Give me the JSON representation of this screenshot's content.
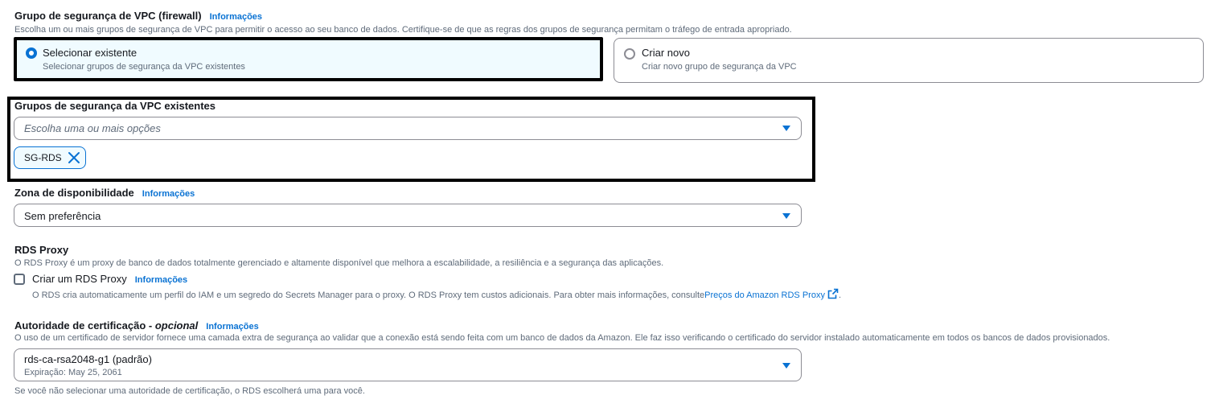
{
  "vpc_sg": {
    "title": "Grupo de segurança de VPC (firewall)",
    "info": "Informações",
    "description": "Escolha um ou mais grupos de segurança de VPC para permitir o acesso ao seu banco de dados. Certifique-se de que as regras dos grupos de segurança permitam o tráfego de entrada apropriado.",
    "options": [
      {
        "label": "Selecionar existente",
        "description": "Selecionar grupos de segurança da VPC existentes",
        "selected": true
      },
      {
        "label": "Criar novo",
        "description": "Criar novo grupo de segurança da VPC",
        "selected": false
      }
    ]
  },
  "existing_sg": {
    "title": "Grupos de segurança da VPC existentes",
    "placeholder": "Escolha uma ou mais opções",
    "tokens": [
      "SG-RDS"
    ]
  },
  "az": {
    "title": "Zona de disponibilidade",
    "info": "Informações",
    "value": "Sem preferência"
  },
  "rds_proxy": {
    "title": "RDS Proxy",
    "description": "O RDS Proxy é um proxy de banco de dados totalmente gerenciado e altamente disponível que melhora a escalabilidade, a resiliência e a segurança das aplicações.",
    "checkbox_label": "Criar um RDS Proxy",
    "info": "Informações",
    "checked": false,
    "sub_description": "O RDS cria automaticamente um perfil do IAM e um segredo do Secrets Manager para o proxy. O RDS Proxy tem custos adicionais. Para obter mais informações, consulte",
    "link": "Preços do Amazon RDS Proxy",
    "after_link": "."
  },
  "ca": {
    "title": "Autoridade de certificação - ",
    "optional": "opcional",
    "info": "Informações",
    "description": "O uso de um certificado de servidor fornece uma camada extra de segurança ao validar que a conexão está sendo feita com um banco de dados da Amazon. Ele faz isso verificando o certificado do servidor instalado automaticamente em todos os bancos de dados provisionados.",
    "value": "rds-ca-rsa2048-g1 (padrão)",
    "expiry": "Expiração: May 25, 2061",
    "footer": "Se você não selecionar uma autoridade de certificação, o RDS escolherá uma para você."
  },
  "colors": {
    "accent": "#0972d3",
    "text": "#16191f",
    "muted": "#5f6b7a",
    "border": "#8c8c94",
    "selected_bg": "#f0fbff"
  }
}
